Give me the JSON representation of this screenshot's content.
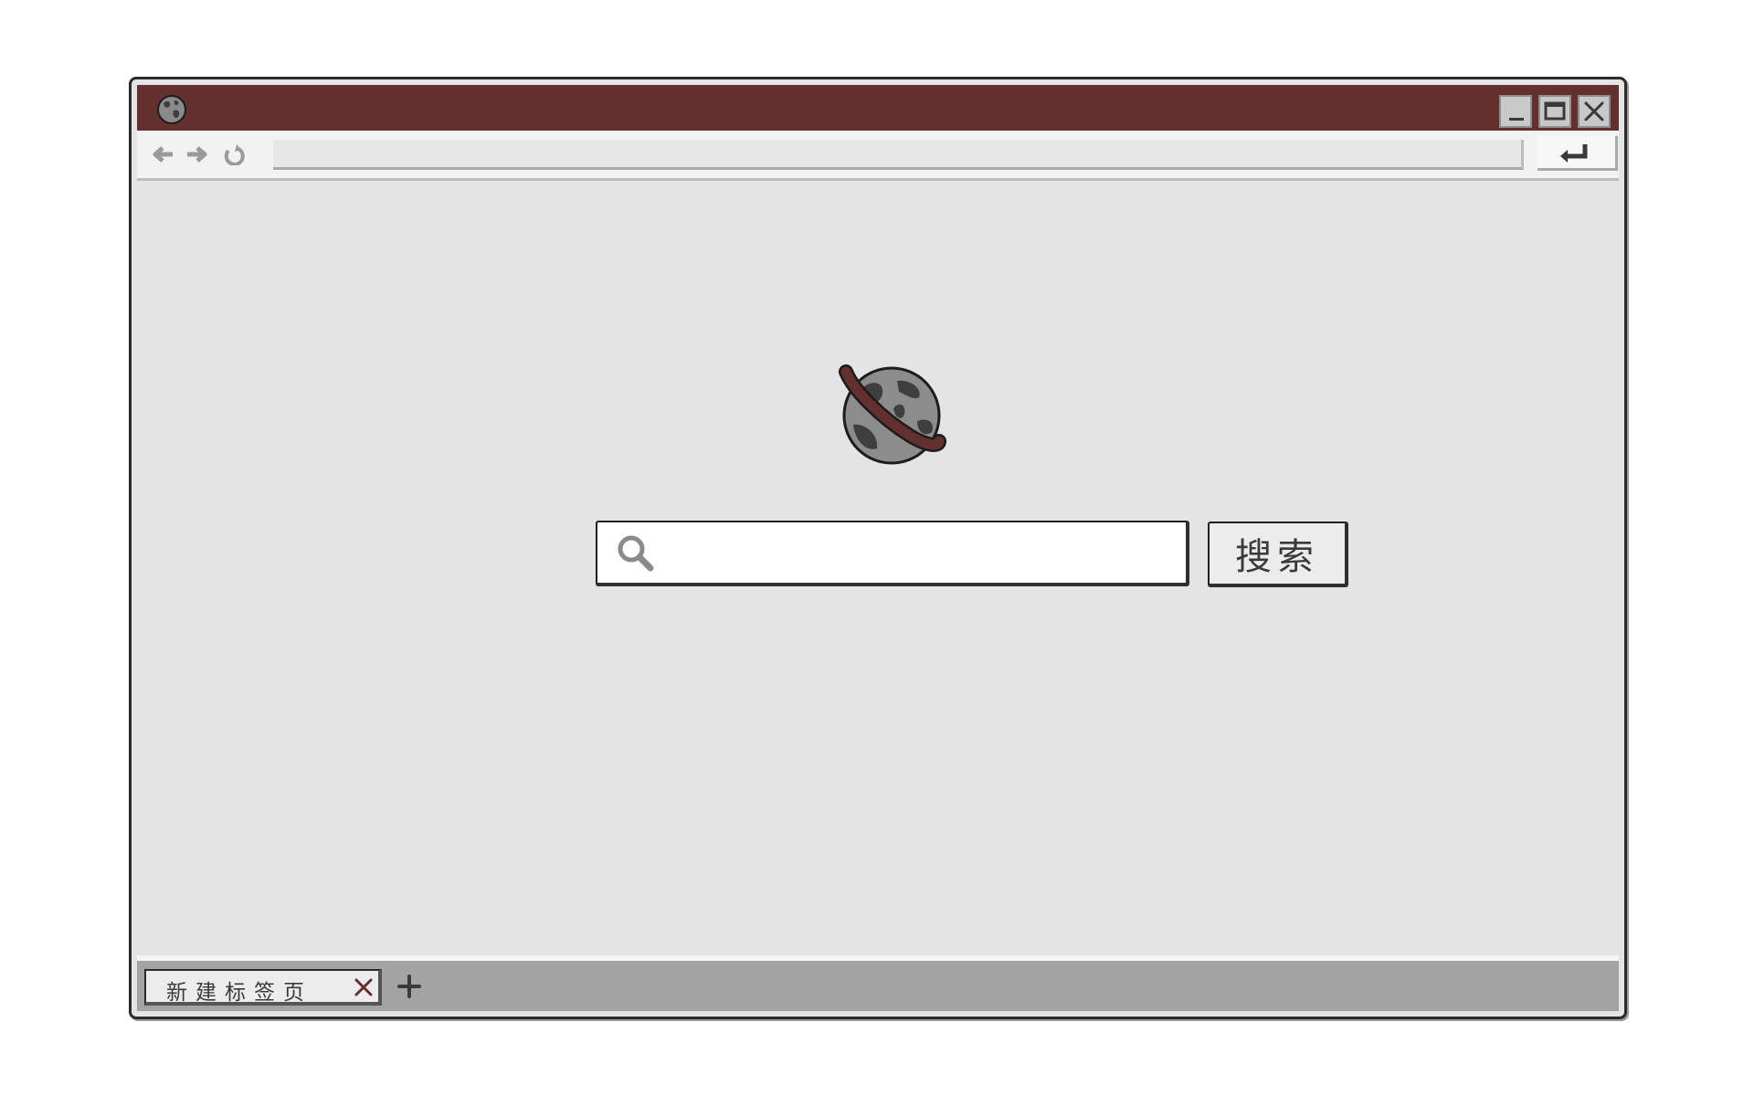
{
  "window": {
    "title_icon": "globe-icon",
    "controls": [
      "minimize-icon",
      "maximize-icon",
      "close-icon"
    ],
    "accent_color": "#632f2f"
  },
  "toolbar": {
    "nav_icons": [
      "back-arrow-icon",
      "forward-arrow-icon",
      "refresh-icon"
    ],
    "address_value": "",
    "go_icon": "enter-icon"
  },
  "main": {
    "logo_icon": "planet-icon",
    "search_placeholder": "",
    "search_value": "",
    "search_button_label": "搜索"
  },
  "tabs": {
    "items": [
      {
        "label": "新建标签页",
        "active": true
      }
    ],
    "new_tab_icon": "plus-icon"
  }
}
